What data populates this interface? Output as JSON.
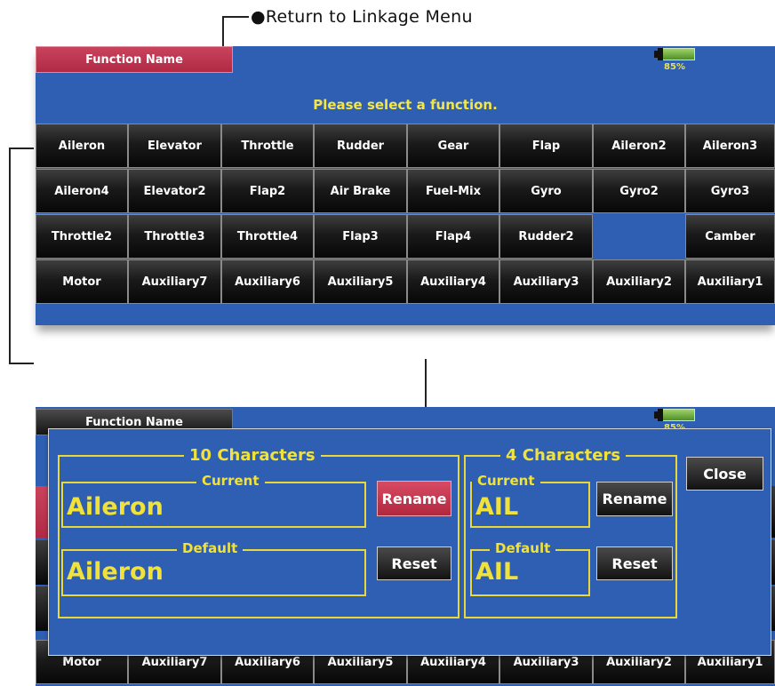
{
  "callout": {
    "text": "●Return to Linkage Menu"
  },
  "top_screen": {
    "tab_label": "Function Name",
    "battery_percent": "85%",
    "prompt": "Please select a function.",
    "functions": [
      [
        "Aileron",
        "Elevator",
        "Throttle",
        "Rudder",
        "Gear",
        "Flap",
        "Aileron2",
        "Aileron3"
      ],
      [
        "Aileron4",
        "Elevator2",
        "Flap2",
        "Air Brake",
        "Fuel-Mix",
        "Gyro",
        "Gyro2",
        "Gyro3"
      ],
      [
        "Throttle2",
        "Throttle3",
        "Throttle4",
        "Flap3",
        "Flap4",
        "Rudder2",
        "",
        "Camber"
      ],
      [
        "Motor",
        "Auxiliary7",
        "Auxiliary6",
        "Auxiliary5",
        "Auxiliary4",
        "Auxiliary3",
        "Auxiliary2",
        "Auxiliary1"
      ]
    ]
  },
  "bottom_screen": {
    "tab_label": "Function Name",
    "battery_percent": "85%",
    "background_row": [
      "Motor",
      "Auxiliary7",
      "Auxiliary6",
      "Auxiliary5",
      "Auxiliary4",
      "Auxiliary3",
      "Auxiliary2",
      "Auxiliary1"
    ],
    "dialog": {
      "ten_chars_title": "10 Characters",
      "four_chars_title": "4 Characters",
      "current_label": "Current",
      "default_label": "Default",
      "current_long": "Aileron",
      "default_long": "Aileron",
      "current_short": "AIL",
      "default_short": "AIL",
      "rename_label": "Rename",
      "reset_label": "Reset",
      "close_label": "Close"
    }
  },
  "colors": {
    "screen_blue": "#2f5fb3",
    "accent_red": "#b83350",
    "text_yellow": "#f0e23b",
    "battery_green": "#6fb23e"
  }
}
